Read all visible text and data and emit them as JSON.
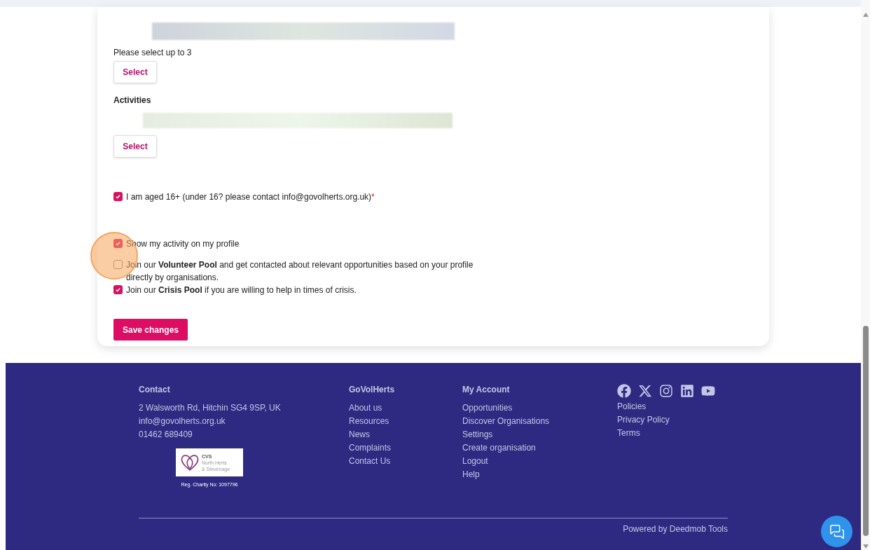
{
  "form": {
    "causes_hint": "Please select up to 3",
    "causes_button": "Select",
    "activities_label": "Activities",
    "activities_button": "Select",
    "age_check": {
      "label": "I am aged 16+ (under 16? please contact info@govolherts.org.uk)",
      "required_mark": "*",
      "checked": true
    },
    "options": [
      {
        "label": "Show my activity on my profile",
        "checked": true
      },
      {
        "label": "Join our **Volunteer Pool** and get contacted about relevant opportunities based on your profile directly by organisations.",
        "checked": false
      },
      {
        "label": "Join our **Crisis Pool** if you are willing to help in times of crisis.",
        "checked": true
      }
    ],
    "save_button": "Save changes"
  },
  "footer": {
    "contact": {
      "heading": "Contact",
      "lines": [
        "2 Walsworth Rd, Hitchin SG4 9SP, UK",
        "info@govolherts.org.uk",
        "01462 689409"
      ],
      "logo": {
        "line_1": "CVS",
        "line_2": "North Herts",
        "line_3": "& Stevenage"
      },
      "charity": "Reg. Charity No: 1097796"
    },
    "columns": [
      {
        "heading": "GoVolHerts",
        "links": [
          "About us",
          "Resources",
          "News",
          "Complaints",
          "Contact Us"
        ]
      },
      {
        "heading": "My Account",
        "links": [
          "Opportunities",
          "Discover Organisations",
          "Settings",
          "Create organisation",
          "Logout",
          "Help"
        ]
      }
    ],
    "policy_links": [
      "Policies",
      "Privacy Policy",
      "Terms"
    ],
    "powered_by": "Powered by Deedmob Tools"
  }
}
